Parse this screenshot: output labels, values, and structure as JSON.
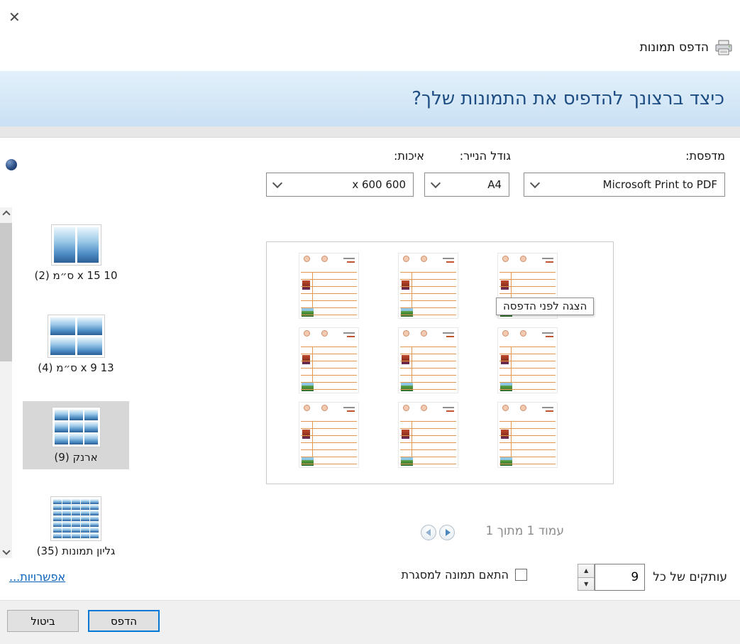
{
  "window": {
    "title": "הדפס תמונות",
    "close_glyph": "✕"
  },
  "banner": {
    "heading": "כיצד ברצונך להדפיס את התמונות שלך?"
  },
  "settings": {
    "printer": {
      "label": "מדפסת:",
      "value": "Microsoft Print to PDF"
    },
    "paper": {
      "label": "גודל הנייר:",
      "value": "A4"
    },
    "quality": {
      "label": "איכות:",
      "value": "x 600 600"
    }
  },
  "sidebar": {
    "items": [
      {
        "label": "10 x 15 ס״מ (2)",
        "rows": 1,
        "cols": 2,
        "selected": false
      },
      {
        "label": "13 x 9 ס״מ (4)",
        "rows": 2,
        "cols": 2,
        "selected": false
      },
      {
        "label": "ארנק (9)",
        "rows": 3,
        "cols": 3,
        "selected": true
      },
      {
        "label": "גליון תמונות (35)",
        "rows": 7,
        "cols": 5,
        "selected": false
      }
    ]
  },
  "preview": {
    "tooltip": "הצגה לפני הדפסה",
    "page_status": "עמוד 1 מתוך 1",
    "grid_rows": 3,
    "grid_cols": 3
  },
  "footer": {
    "options_link": "אפשרויות...",
    "fit_label": "התאם תמונה למסגרת",
    "fit_checked": false,
    "copies_label": "עותקים של כל",
    "copies_value": "9"
  },
  "actions": {
    "print": "הדפס",
    "cancel": "ביטול"
  },
  "icons": {
    "spin_up": "▲",
    "spin_down": "▼"
  },
  "colors": {
    "accent": "#0078d7",
    "banner_text": "#1d4d82",
    "card_line": "#e2984e"
  }
}
